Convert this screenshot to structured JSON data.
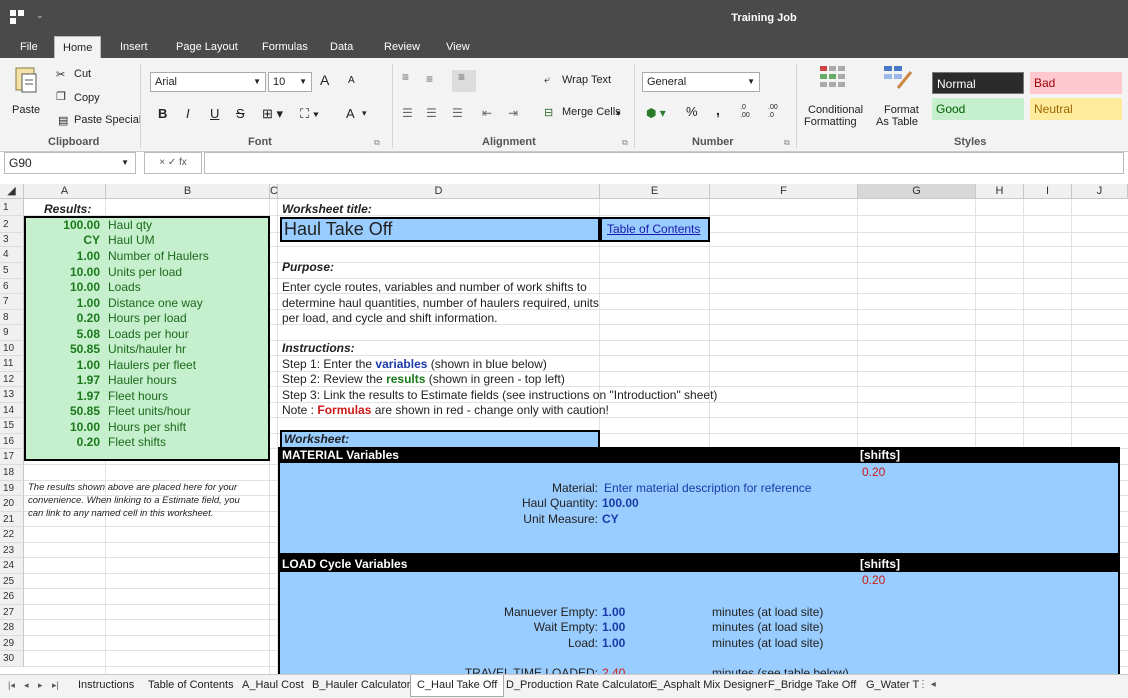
{
  "window": {
    "title": "Training Job"
  },
  "menu": [
    "File",
    "Home",
    "Insert",
    "Page Layout",
    "Formulas",
    "Data",
    "Review",
    "View"
  ],
  "ribbon": {
    "clipboard": {
      "cut": "Cut",
      "copy": "Copy",
      "paste": "Paste",
      "paste_special": "Paste Special",
      "label": "Clipboard"
    },
    "font": {
      "name": "Arial",
      "size": "10",
      "grow": "A",
      "shrink": "A",
      "bold": "B",
      "italic": "I",
      "underline": "U",
      "strike": "S",
      "fontcolor": "A",
      "label": "Font"
    },
    "alignment": {
      "wrap": "Wrap Text",
      "merge": "Merge Cells",
      "label": "Alignment"
    },
    "number": {
      "format": "General",
      "percent": "%",
      "comma": ",",
      "inc_dec": ".0\n.00",
      "dec_dec": ".00\n.0",
      "label": "Number"
    },
    "styles": {
      "conditional": "Conditional",
      "conditional2": "Formatting",
      "format_table": "Format",
      "format_table2": "As Table",
      "label": "Styles",
      "normal": "Normal",
      "bad": "Bad",
      "good": "Good",
      "neutral": "Neutral"
    }
  },
  "formula_bar": {
    "name_box": "G90",
    "tools": "× ✓ fx",
    "value": ""
  },
  "columns": [
    "A",
    "B",
    "C",
    "D",
    "E",
    "F",
    "G",
    "H",
    "I",
    "J"
  ],
  "rows": [
    "1",
    "2",
    "3",
    "4",
    "5",
    "6",
    "7",
    "8",
    "9",
    "10",
    "11",
    "12",
    "13",
    "14",
    "15",
    "16",
    "17",
    "18",
    "19",
    "20",
    "21",
    "22",
    "23",
    "24",
    "25",
    "26",
    "27",
    "28",
    "29",
    "30"
  ],
  "results": {
    "header": "Results:",
    "items": [
      {
        "value": "100.00",
        "label": "Haul qty"
      },
      {
        "value": "CY",
        "label": "Haul UM"
      },
      {
        "value": "1.00",
        "label": "Number of Haulers"
      },
      {
        "value": "10.00",
        "label": "Units per load"
      },
      {
        "value": "10.00",
        "label": "Loads"
      },
      {
        "value": "1.00",
        "label": "Distance one way"
      },
      {
        "value": "0.20",
        "label": "Hours per load"
      },
      {
        "value": "5.08",
        "label": "Loads per hour"
      },
      {
        "value": "50.85",
        "label": "Units/hauler hr"
      },
      {
        "value": "1.00",
        "label": "Haulers per fleet"
      },
      {
        "value": "1.97",
        "label": "Hauler hours"
      },
      {
        "value": "1.97",
        "label": "Fleet hours"
      },
      {
        "value": "50.85",
        "label": "Fleet units/hour"
      },
      {
        "value": "10.00",
        "label": "Hours per shift"
      },
      {
        "value": "0.20",
        "label": "Fleet shifts"
      }
    ],
    "note": [
      "The results shown above are placed here for your",
      "convenience. When linking to a Estimate field, you",
      "can link to any named cell in this worksheet."
    ]
  },
  "sheet": {
    "worksheet_title_label": "Worksheet title:",
    "title": "Haul Take Off",
    "toc_link": "Table of Contents",
    "purpose_label": "Purpose:",
    "purpose": [
      "Enter cycle routes, variables and number of work shifts to",
      "determine haul quantities, number of haulers required, units",
      "per load, and cycle and shift information."
    ],
    "instructions_label": "Instructions:",
    "step1_a": "Step 1: Enter the ",
    "step1_b": "variables",
    "step1_c": " (shown in blue below)",
    "step2_a": "Step 2: Review the ",
    "step2_b": "results",
    "step2_c": " (shown in green - top left)",
    "step3": "Step 3: Link the results to Estimate fields (see instructions on \"Introduction\" sheet)",
    "note_a": " Note : ",
    "note_b": "Formulas",
    "note_c": " are shown in red - change only with caution!",
    "worksheet_label": "Worksheet:",
    "material": {
      "header": "MATERIAL Variables",
      "shifts_label": "[shifts]",
      "shifts": "0.20",
      "material_label": "Material:",
      "material_value": "Enter material description for reference",
      "qty_label": "Haul Quantity:",
      "qty_value": "100.00",
      "um_label": "Unit Measure:",
      "um_value": "CY"
    },
    "load": {
      "header": "LOAD Cycle Variables",
      "shifts_label": "[shifts]",
      "shifts": "0.20",
      "rows": [
        {
          "label": "Manuever Empty:",
          "value": "1.00",
          "unit": "minutes (at load site)"
        },
        {
          "label": "Wait Empty:",
          "value": "1.00",
          "unit": "minutes (at load site)"
        },
        {
          "label": "Load:",
          "value": "1.00",
          "unit": "minutes (at load site)"
        }
      ],
      "travel_label": "TRAVEL TIME LOADED:",
      "travel_value": "2.40",
      "travel_unit": "minutes (see table below)"
    }
  },
  "sheet_tabs": [
    "Instructions",
    "Table of Contents",
    "A_Haul Cost",
    "B_Hauler Calculator",
    "C_Haul Take Off",
    "D_Production Rate Calculator",
    "E_Asphalt Mix Designer",
    "F_Bridge Take Off",
    "G_Water T"
  ],
  "colors": {
    "accent": "#4a4a4a",
    "result_bg": "#c6efce",
    "blue_bg": "#99ccff",
    "black_bar": "#000000"
  }
}
